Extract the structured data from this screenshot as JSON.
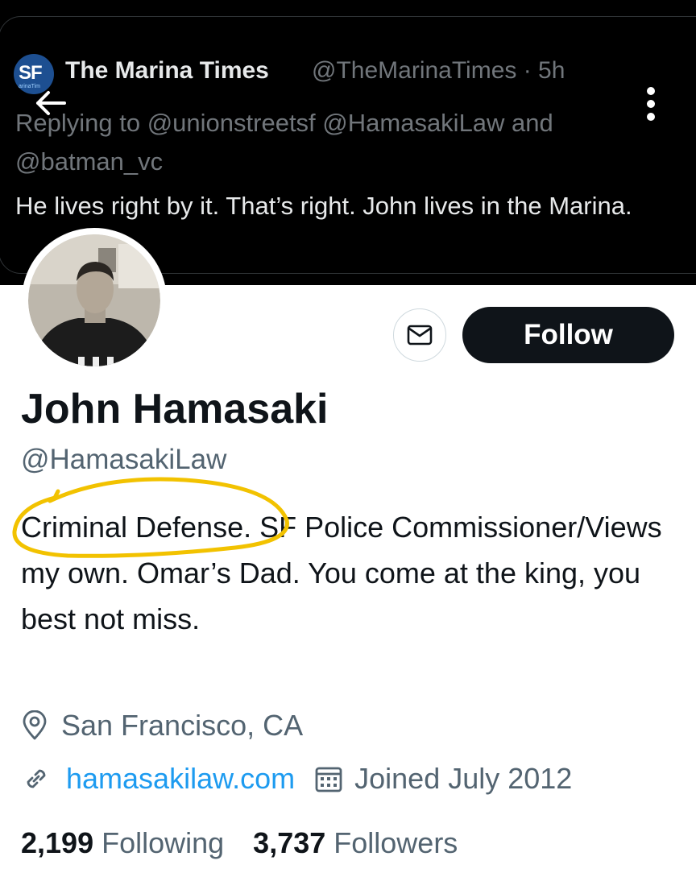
{
  "header": {
    "quoted_tweet": {
      "avatar_text": "SF",
      "avatar_subtext": "arinaTim",
      "author_name": "The Marina Times",
      "author_meta": "@TheMarinaTimes · 5h",
      "reply_line": "Replying to @unionstreetsf @HamasakiLaw and @batman_vc",
      "text": "He lives right by it. That’s right. John lives in the Marina."
    }
  },
  "profile": {
    "name": "John Hamasaki",
    "handle": "@HamasakiLaw",
    "follow_label": "Follow",
    "bio": "Criminal Defense. SF Police Commissioner/Views my own. Omar’s Dad. You come at the king, you best not miss.",
    "location": "San Francisco, CA",
    "website": "hamasakilaw.com",
    "joined": "Joined July 2012",
    "stats": {
      "following_count": "2,199",
      "following_label": "Following",
      "followers_count": "3,737",
      "followers_label": "Followers"
    }
  },
  "icons": {
    "back": "arrow-left-icon",
    "more": "more-vertical-icon",
    "message": "envelope-icon",
    "location": "location-pin-icon",
    "link": "link-icon",
    "calendar": "calendar-icon"
  },
  "colors": {
    "link": "#1d9bf0",
    "follow_bg": "#0f1419",
    "highlight": "#f2c200",
    "secondary_text": "#536471"
  }
}
